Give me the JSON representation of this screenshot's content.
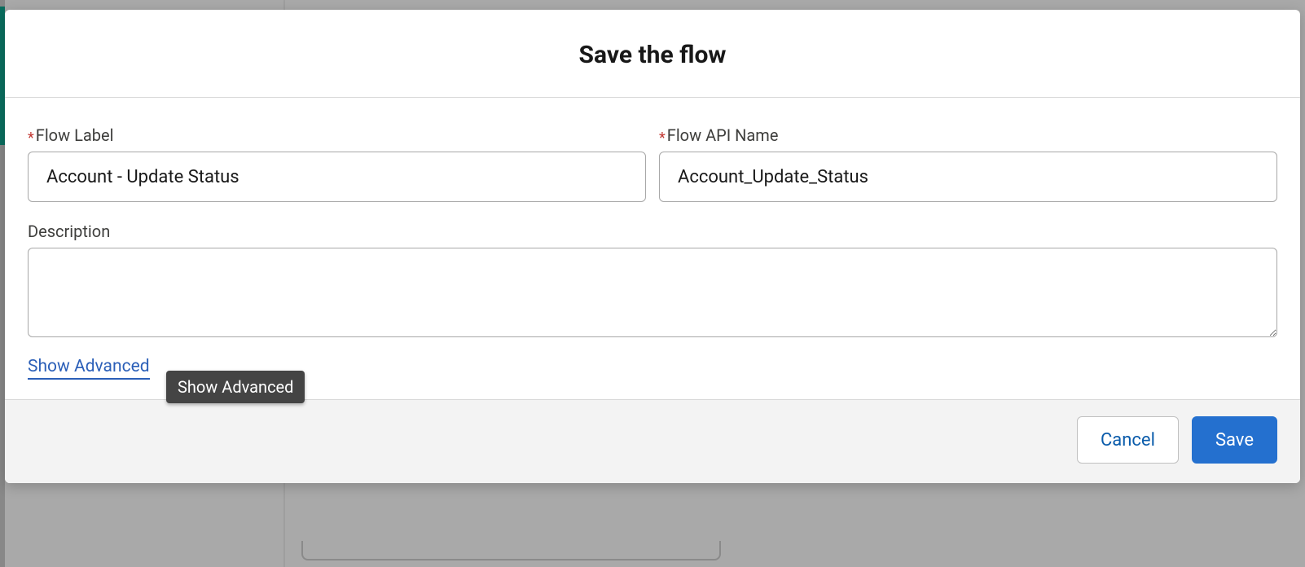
{
  "modal": {
    "title": "Save the flow",
    "fields": {
      "flowLabel": {
        "label": "Flow Label",
        "required": true,
        "value": "Account - Update Status"
      },
      "flowApiName": {
        "label": "Flow API Name",
        "required": true,
        "value": "Account_Update_Status"
      },
      "description": {
        "label": "Description",
        "required": false,
        "value": ""
      }
    },
    "showAdvancedLink": "Show Advanced",
    "tooltip": "Show Advanced",
    "footer": {
      "cancel": "Cancel",
      "save": "Save"
    }
  }
}
